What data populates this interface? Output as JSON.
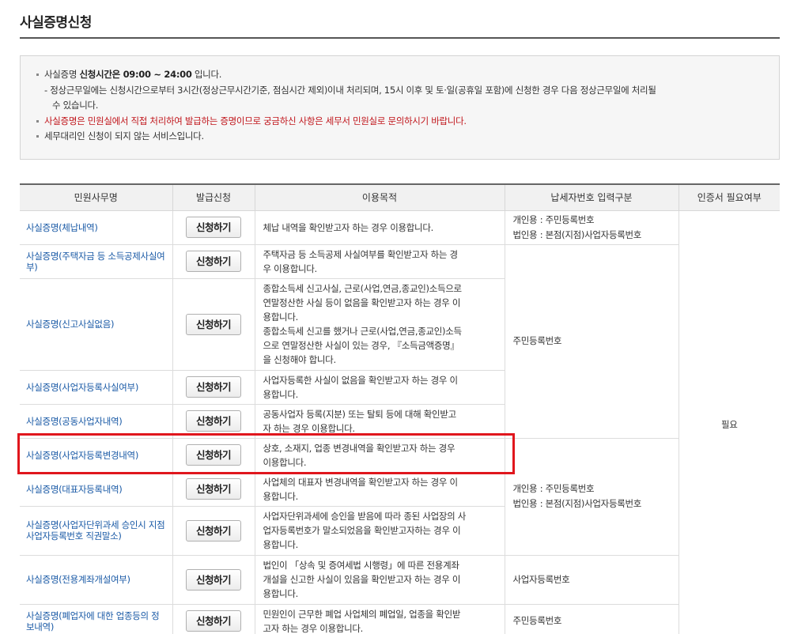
{
  "page": {
    "title": "사실증명신청"
  },
  "notice": {
    "line1_prefix": "사실증명 ",
    "line1_bold": "신청시간은 09:00 ~ 24:00",
    "line1_suffix": " 입니다.",
    "line2": "- 정상근무일에는 신청시간으로부터 3시간(정상근무시간기준, 점심시간 제외)이내 처리되며, 15시 이후 및 토·일(공휴일 포함)에 신청한 경우 다음 정상근무일에 처리될",
    "line3": "수 있습니다.",
    "line4": "사실증명은 민원실에서 직접 처리하여 발급하는 증명이므로 궁금하신 사항은 세무서 민원실로 문의하시기 바랍니다.",
    "line5": "세무대리인 신청이 되지 않는 서비스입니다."
  },
  "table": {
    "headers": {
      "name": "민원사무명",
      "apply": "발급신청",
      "purpose": "이용목적",
      "taxno": "납세자번호 입력구분",
      "cert": "인증서 필요여부"
    },
    "button_label": "신청하기",
    "cert_value": "필요",
    "rows": [
      {
        "name": "사실증명(체납내역)",
        "purpose": [
          "체납 내역을 확인받고자 하는 경우 이용합니다."
        ]
      },
      {
        "name": "사실증명(주택자금 등 소득공제사실여부)",
        "purpose": [
          "주택자금 등 소득공제 사실여부를 확인받고자 하는 경",
          "우 이용합니다."
        ]
      },
      {
        "name": "사실증명(신고사실없음)",
        "purpose": [
          "종합소득세 신고사실, 근로(사업,연금,종교인)소득으로",
          "연말정산한 사실 등이 없음을 확인받고자 하는 경우 이",
          "용합니다.",
          "종합소득세 신고를 했거나 근로(사업,연금,종교인)소득",
          "으로 연말정산한 사실이 있는 경우, 『소득금액증명』",
          "을 신청해야 합니다."
        ]
      },
      {
        "name": "사실증명(사업자등록사실여부)",
        "purpose": [
          "사업자등록한 사실이 없음을 확인받고자 하는 경우 이",
          "용합니다."
        ]
      },
      {
        "name": "사실증명(공동사업자내역)",
        "purpose": [
          "공동사업자 등록(지분) 또는 탈퇴 등에 대해 확인받고",
          "자 하는 경우 이용합니다."
        ]
      },
      {
        "name": "사실증명(사업자등록변경내역)",
        "purpose": [
          "상호, 소재지, 업종 변경내역을 확인받고자 하는 경우",
          "이용합니다."
        ]
      },
      {
        "name": "사실증명(대표자등록내역)",
        "purpose": [
          "사업체의 대표자 변경내역을 확인받고자 하는 경우 이",
          "용합니다."
        ]
      },
      {
        "name": "사실증명(사업자단위과세 승인시 지점사업자등록번호 직권말소)",
        "purpose": [
          "사업자단위과세에 승인을 받음에 따라 종된 사업장의 사",
          "업자등록번호가 말소되었음을 확인받고자하는 경우 이",
          "용합니다."
        ]
      },
      {
        "name": "사실증명(전용계좌개설여부)",
        "purpose": [
          "법인이 「상속 및 증여세법 시행령」에 따른 전용계좌",
          "개설을 신고한 사실이 있음을 확인받고자 하는 경우 이",
          "용합니다."
        ]
      },
      {
        "name": "사실증명(폐업자에 대한 업종등의 정보내역)",
        "purpose": [
          "민원인이 근무한 폐업 사업체의 폐업일, 업종을 확인받",
          "고자 하는 경우 이용합니다."
        ]
      }
    ],
    "taxno_groups": [
      {
        "lines": [
          "개인용 : 주민등록번호",
          "법인용 : 본점(지점)사업자등록번호"
        ]
      },
      {
        "lines": [
          "주민등록번호"
        ]
      },
      {
        "lines": [
          "개인용 : 주민등록번호",
          "법인용 : 본점(지점)사업자등록번호"
        ]
      },
      {
        "lines": [
          "사업자등록번호"
        ]
      },
      {
        "lines": [
          "주민등록번호"
        ]
      }
    ]
  }
}
